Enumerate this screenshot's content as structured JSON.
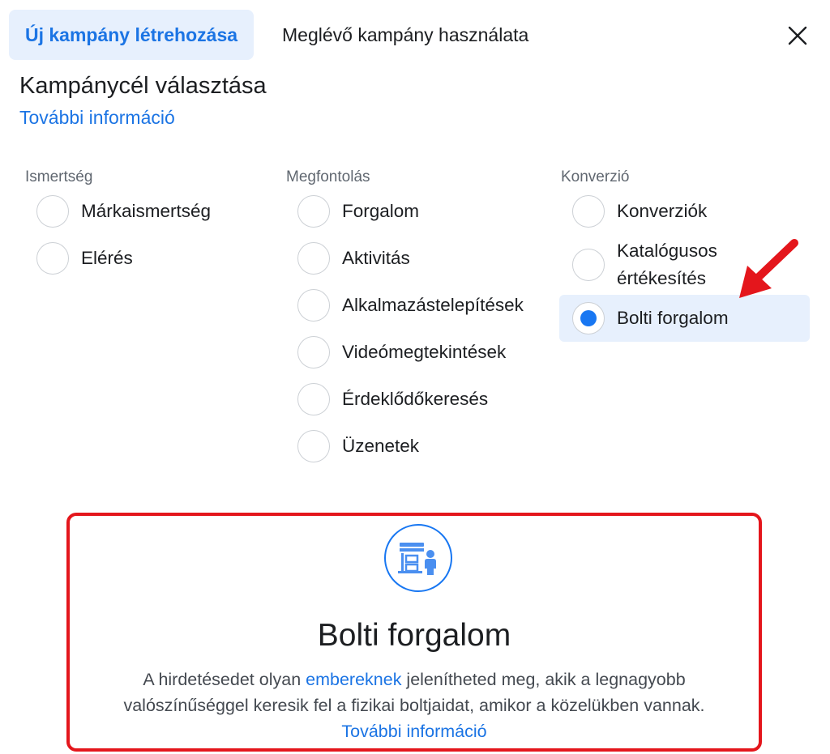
{
  "tabs": {
    "new_campaign": "Új kampány létrehozása",
    "existing_campaign": "Meglévő kampány használata"
  },
  "header": {
    "title": "Kampánycél választása",
    "learn_more": "További információ"
  },
  "columns": [
    {
      "heading": "Ismertség",
      "options": [
        {
          "label": "Márkaismertség",
          "selected": false
        },
        {
          "label": "Elérés",
          "selected": false
        }
      ]
    },
    {
      "heading": "Megfontolás",
      "options": [
        {
          "label": "Forgalom",
          "selected": false
        },
        {
          "label": "Aktivitás",
          "selected": false
        },
        {
          "label": "Alkalmazástelepítések",
          "selected": false
        },
        {
          "label": "Videómegtekintések",
          "selected": false
        },
        {
          "label": "Érdeklődőkeresés",
          "selected": false
        },
        {
          "label": "Üzenetek",
          "selected": false
        }
      ]
    },
    {
      "heading": "Konverzió",
      "options": [
        {
          "label": "Konverziók",
          "selected": false
        },
        {
          "label_line1": "Katalógusos",
          "label_line2": "értékesítés",
          "selected": false
        },
        {
          "label": "Bolti forgalom",
          "selected": true
        }
      ]
    }
  ],
  "detail": {
    "icon": "store-visit-icon",
    "title": "Bolti forgalom",
    "desc_part1": "A hirdetésedet olyan ",
    "desc_link1": "embereknek",
    "desc_part2": " jelenítheted meg, akik a legnagyobb valószínűséggel keresik fel a fizikai boltjaidat, amikor a közelükben vannak. ",
    "desc_link2": "További információ"
  },
  "colors": {
    "accent": "#1877f2",
    "annotation_red": "#e4161c",
    "selected_bg": "#e7f0fd"
  }
}
